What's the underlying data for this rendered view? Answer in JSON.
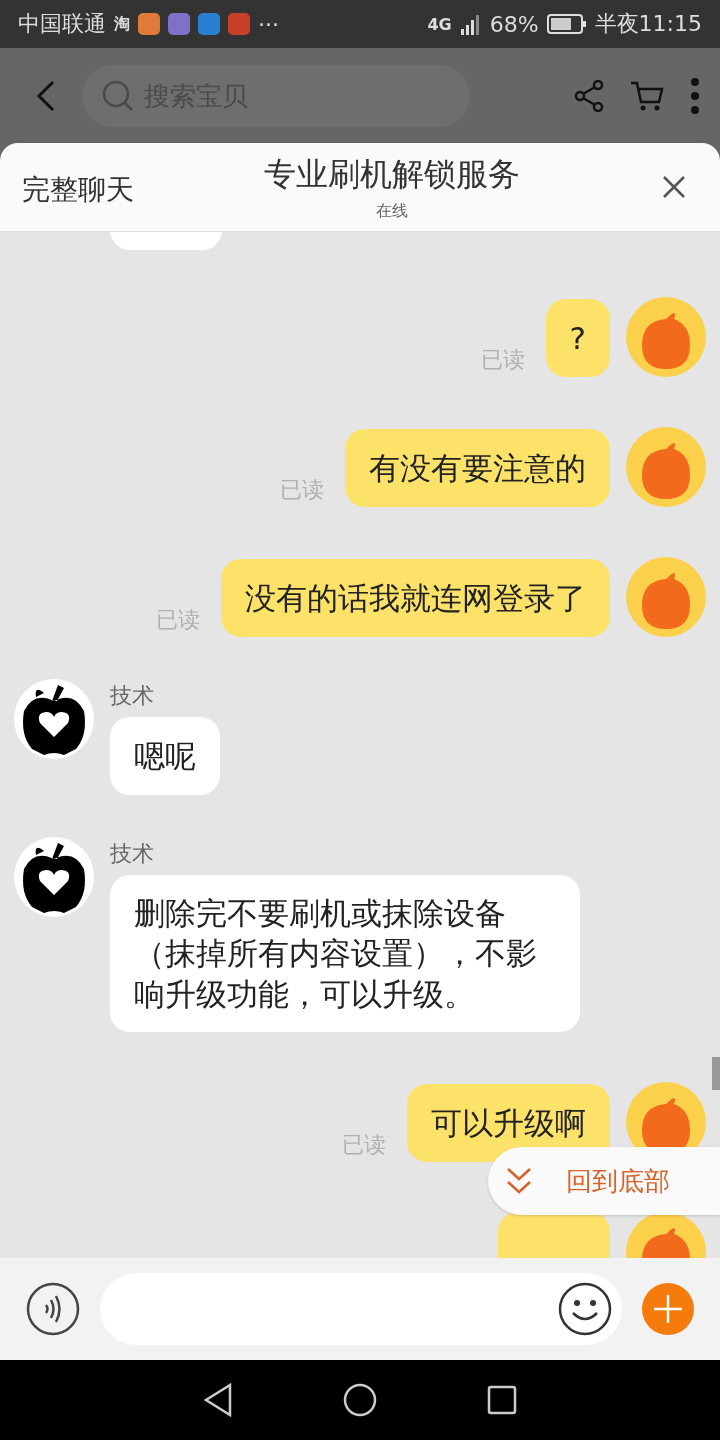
{
  "status_bar": {
    "carrier": "中国联通",
    "app_icon_text": "淘",
    "more": "···",
    "network": "4G",
    "battery": "68%",
    "time": "半夜11:15"
  },
  "top_bar": {
    "search": {
      "placeholder": "搜索宝贝"
    }
  },
  "chat_header": {
    "full_chat": "完整聊天",
    "title": "专业刷机解锁服务",
    "status": "在线"
  },
  "messages": [
    {
      "kind": "out",
      "text": "?",
      "read_label": "已读"
    },
    {
      "kind": "out",
      "text": "有没有要注意的",
      "read_label": "已读"
    },
    {
      "kind": "out",
      "text": "没有的话我就连网登录了",
      "read_label": "已读"
    },
    {
      "kind": "in",
      "sender": "技术",
      "text": "嗯呢"
    },
    {
      "kind": "in",
      "sender": "技术",
      "text": "删除完不要刷机或抹除设备（抹掉所有内容设置），不影响升级功能，可以升级。"
    },
    {
      "kind": "out",
      "text": "可以升级啊",
      "read_label": "已读"
    }
  ],
  "scroll_to_bottom": "回到底部"
}
